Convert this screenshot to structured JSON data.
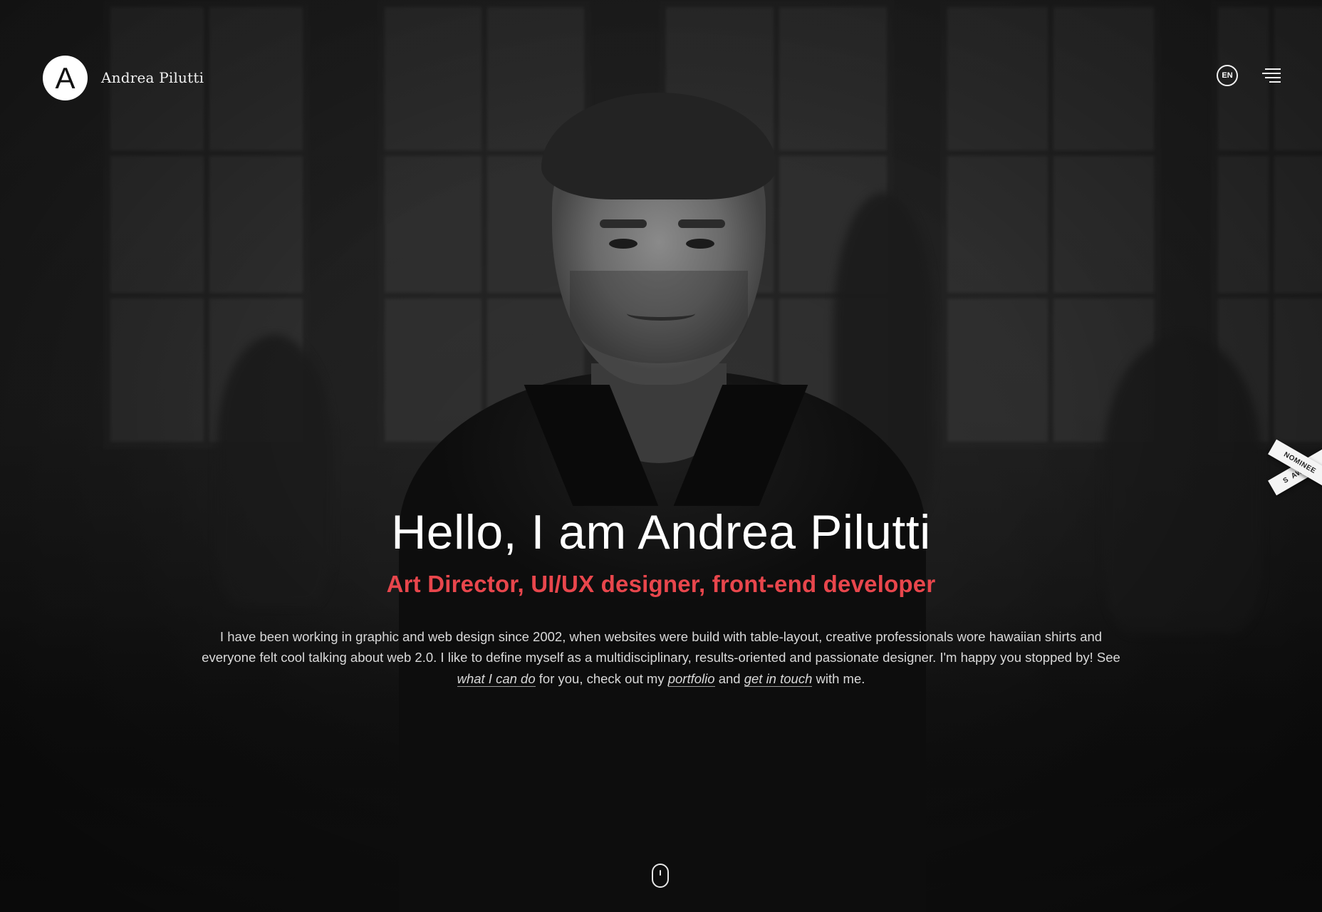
{
  "header": {
    "logo_letter": "A",
    "brand_name": "Andrea Pilutti",
    "language": "EN",
    "menu_icon": "hamburger-icon"
  },
  "award": {
    "top_label": "AWARD",
    "bottom_label": "NOMINEE",
    "mark": "S"
  },
  "hero": {
    "title": "Hello, I am Andrea Pilutti",
    "subtitle": "Art Director, UI/UX designer, front-end developer",
    "intro_text": "I have been working in graphic and web design since 2002, when websites were build with table-layout, creative professionals wore hawaiian shirts and everyone felt cool talking about web 2.0. I like to define myself as a multidisciplinary, results-oriented and passionate designer. I'm happy you stopped by! See",
    "link_what_i_can_do": "what I can do",
    "text_for_you": "for you, check out my",
    "link_portfolio": "portfolio",
    "text_and": "and",
    "link_get_in_touch": "get in touch",
    "text_end": "with me."
  },
  "scroll_indicator": {
    "icon": "mouse-scroll-icon"
  },
  "colors": {
    "accent": "#e8464c",
    "background": "#1f1f1f",
    "text": "#d9d9d9"
  }
}
